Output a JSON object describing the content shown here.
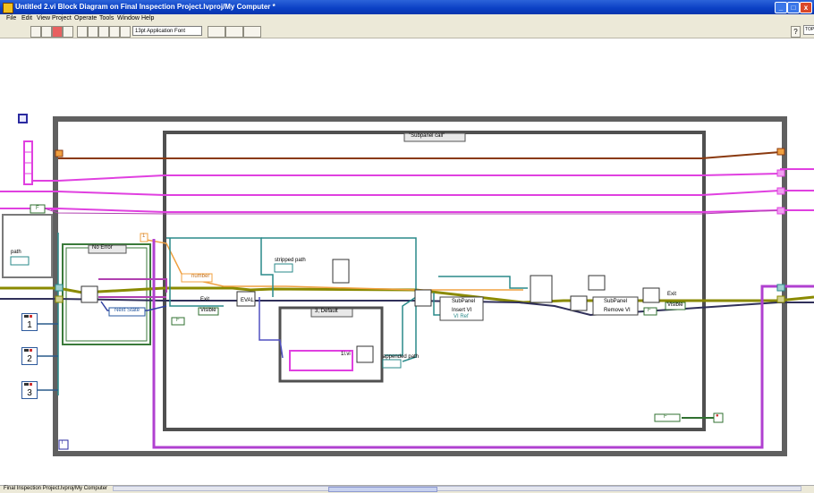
{
  "window": {
    "title": "Untitled 2.vi Block Diagram on Final Inspection Project.lvproj/My Computer *",
    "minimize": "_",
    "maximize": "□",
    "close": "x"
  },
  "menu": [
    "File",
    "Edit",
    "View",
    "Project",
    "Operate",
    "Tools",
    "Window",
    "Help"
  ],
  "toolbar": {
    "font": "13pt Application Font",
    "top_right": "TOP"
  },
  "diagram": {
    "case_selector_outer": "No Error",
    "case_selector_main": "\"Subpanel call\"",
    "case_selector_inner": "3, Default",
    "labels": {
      "path": "path",
      "number": "number",
      "next_state": "Next State",
      "exit_left": "Exit",
      "visible_left": "Visible",
      "eval": "EVAL",
      "stripped_path": "stripped path",
      "appended_path": "appended path",
      "vi_name": "1l.vi",
      "subpanel_insert": "SubPanel",
      "insert_vi": "Insert VI",
      "vi_ref": "VI Ref",
      "subpanel_remove": "SubPanel",
      "remove_vi": "Remove VI",
      "exit_right": "Exit",
      "visible_right": "Visible",
      "iteration": "i",
      "numeric_1": "1",
      "numeric_2": "2",
      "numeric_3": "3",
      "false_const": "F",
      "false_const_mid": "F",
      "false_const_bottom": "F",
      "false_const_top": "F",
      "index_const": "1",
      "stop": "●"
    }
  },
  "status": {
    "project": "Final Inspection Project.lvproj/My Computer"
  },
  "colors": {
    "wire_pink": "#e040e0",
    "wire_brown": "#8a3a10",
    "wire_teal": "#2a8a8a",
    "wire_orange": "#f0a040",
    "wire_blue": "#3040a0",
    "wire_olive": "#8a8a00",
    "wire_green": "#307030",
    "frame": "#606060"
  }
}
